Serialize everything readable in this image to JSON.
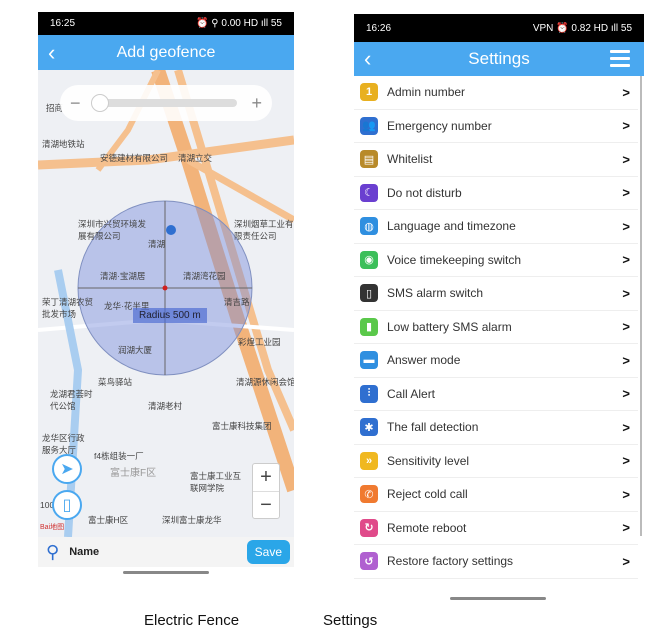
{
  "left": {
    "status": {
      "time": "16:25",
      "right": "⏰ ⚲ 0.00 HD ıll 55"
    },
    "header": {
      "title": "Add geofence",
      "back_icon": "chevron-left-icon"
    },
    "map": {
      "zoom_minus": "−",
      "zoom_plus": "+",
      "radius_label": "Radius 500 m",
      "labels": [
        "招商",
        "清湖地铁站",
        "安德建材有限公司",
        "清湖立交",
        "深圳市兴贸环境发展有限公司",
        "清湖",
        "深圳烟草工业有限责任公司",
        "清湖·宝湖居",
        "清湖湾花园",
        "荣丁清湖农贸批发市场",
        "龙华·花半里",
        "清吉路",
        "润湖大厦",
        "彩煌工业园",
        "菜鸟驿站",
        "清湖源休闲会馆",
        "龙湖君荟时代公馆",
        "清湖老村",
        "富士康科技集团",
        "龙华区行政服务大厅",
        "f4栋组装一厂",
        "富士康F区",
        "富士康工业互联网学院",
        "富士康H区",
        "深圳富士康龙华",
        "100",
        "Bai地图"
      ],
      "map_zoom_in": "+",
      "map_zoom_out": "−"
    },
    "bottom": {
      "name_label": "Name",
      "save_label": "Save"
    }
  },
  "right": {
    "status": {
      "time": "16:26",
      "right": "VPN ⏰ 0.82 HD ıll 55"
    },
    "header": {
      "title": "Settings",
      "back_icon": "chevron-left-icon",
      "menu_icon": "list-menu-icon"
    },
    "items": [
      {
        "label": "Admin number",
        "icon": "admin-number-icon",
        "color": "#e8b020",
        "glyph": "1"
      },
      {
        "label": "Emergency number",
        "icon": "contacts-icon",
        "color": "#2f6fd0",
        "glyph": "👥"
      },
      {
        "label": "Whitelist",
        "icon": "whitelist-icon",
        "color": "#b88a2a",
        "glyph": "▤"
      },
      {
        "label": "Do not disturb",
        "icon": "moon-icon",
        "color": "#6a3fd0",
        "glyph": "☾"
      },
      {
        "label": "Language and timezone",
        "icon": "globe-icon",
        "color": "#2f8fe0",
        "glyph": "◍"
      },
      {
        "label": "Voice timekeeping switch",
        "icon": "voice-icon",
        "color": "#3cbf5a",
        "glyph": "◉"
      },
      {
        "label": "SMS alarm switch",
        "icon": "phone-alarm-icon",
        "color": "#333333",
        "glyph": "▯"
      },
      {
        "label": "Low battery SMS alarm",
        "icon": "battery-icon",
        "color": "#5ac84a",
        "glyph": "▮"
      },
      {
        "label": "Answer mode",
        "icon": "answer-mode-icon",
        "color": "#2f8fe0",
        "glyph": "▬"
      },
      {
        "label": "Call Alert",
        "icon": "equalizer-icon",
        "color": "#2f6fd0",
        "glyph": "⫶"
      },
      {
        "label": "The fall detection",
        "icon": "fall-icon",
        "color": "#2f6fd0",
        "glyph": "✱"
      },
      {
        "label": "Sensitivity level",
        "icon": "sensitivity-icon",
        "color": "#f0b820",
        "glyph": "»"
      },
      {
        "label": "Reject cold call",
        "icon": "reject-call-icon",
        "color": "#f07a30",
        "glyph": "✆"
      },
      {
        "label": "Remote reboot",
        "icon": "reboot-icon",
        "color": "#e04a8a",
        "glyph": "↻"
      },
      {
        "label": "Restore factory settings",
        "icon": "restore-icon",
        "color": "#b060d0",
        "glyph": "↺"
      }
    ]
  },
  "captions": {
    "left": "Electric Fence",
    "right": "Settings"
  },
  "colors": {
    "accent": "#4aa8f0",
    "save": "#2aa6e8"
  }
}
